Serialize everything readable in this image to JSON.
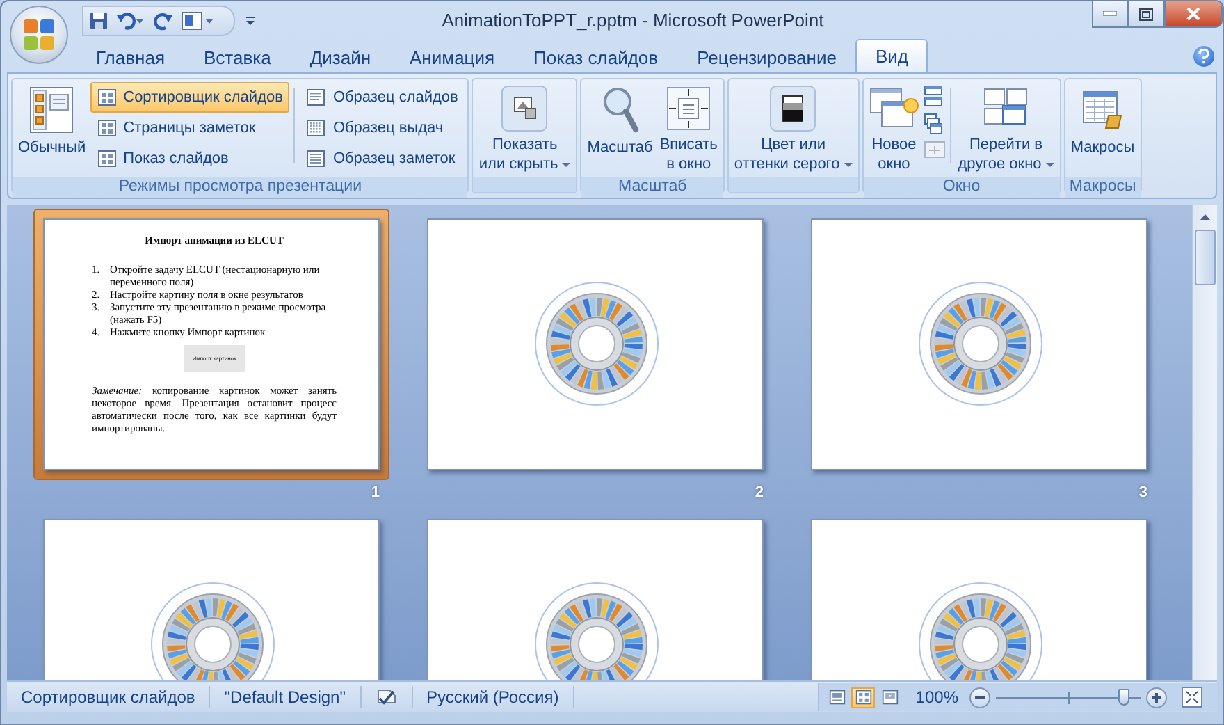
{
  "window": {
    "title": "AnimationToPPT_r.pptm - Microsoft PowerPoint"
  },
  "tabs": [
    {
      "label": "Главная",
      "selected": false
    },
    {
      "label": "Вставка",
      "selected": false
    },
    {
      "label": "Дизайн",
      "selected": false
    },
    {
      "label": "Анимация",
      "selected": false
    },
    {
      "label": "Показ слайдов",
      "selected": false
    },
    {
      "label": "Рецензирование",
      "selected": false
    },
    {
      "label": "Вид",
      "selected": true
    }
  ],
  "ribbon_groups": [
    {
      "label": "Режимы просмотра презентации",
      "items": [
        {
          "kind": "large",
          "lines": [
            "Обычный"
          ],
          "dropdown": false
        },
        {
          "kind": "stack",
          "items": [
            {
              "label": "Сортировщик слайдов",
              "selected": true
            },
            {
              "label": "Страницы заметок",
              "selected": false
            },
            {
              "label": "Показ слайдов",
              "selected": false
            }
          ]
        },
        {
          "kind": "separator"
        },
        {
          "kind": "stack",
          "items": [
            {
              "label": "Образец слайдов",
              "selected": false
            },
            {
              "label": "Образец выдач",
              "selected": false
            },
            {
              "label": "Образец заметок",
              "selected": false
            }
          ]
        }
      ]
    },
    {
      "items": [
        {
          "kind": "large",
          "lines": [
            "Показать",
            "или скрыть"
          ],
          "dropdown": true
        }
      ]
    },
    {
      "label": "Масштаб",
      "items": [
        {
          "kind": "large",
          "lines": [
            "Масштаб"
          ],
          "dropdown": false
        },
        {
          "kind": "large",
          "lines": [
            "Вписать",
            "в окно"
          ],
          "dropdown": false
        }
      ]
    },
    {
      "items": [
        {
          "kind": "large",
          "lines": [
            "Цвет или",
            "оттенки серого"
          ],
          "dropdown": true
        }
      ]
    },
    {
      "label": "Окно",
      "items": [
        {
          "kind": "large",
          "lines": [
            "Новое",
            "окно"
          ],
          "dropdown": false
        },
        {
          "kind": "icons"
        },
        {
          "kind": "separator"
        },
        {
          "kind": "large",
          "lines": [
            "Перейти в",
            "другое окно"
          ],
          "dropdown": true
        }
      ]
    },
    {
      "label": "Макросы",
      "items": [
        {
          "kind": "large",
          "lines": [
            "Макросы"
          ],
          "dropdown": false
        }
      ]
    }
  ],
  "slides": [
    {
      "kind": "text",
      "number": "1",
      "selected": true,
      "title": "Импорт анимации из ELCUT",
      "steps": [
        {
          "number": "1.",
          "text": "Откройте задачу ELCUT (нестационарную или переменного поля)"
        },
        {
          "number": "2.",
          "text": "Настройте картину поля в окне результатов"
        },
        {
          "number": "3.",
          "text": "Запустите эту презентацию в режиме просмотра (нажать F5)"
        },
        {
          "number": "4.",
          "text": "Нажмите кнопку Импорт картинок"
        }
      ],
      "button": "Импорт картинок",
      "note": "*Замечание:* копирование картинок может занять некоторое время. Презентация остановит процесс автоматически после того, как все картинки будут импортированы."
    },
    {
      "kind": "stator",
      "number": "2",
      "selected": false
    },
    {
      "kind": "stator",
      "number": "3",
      "selected": false
    },
    {
      "kind": "stator",
      "selected": false
    },
    {
      "kind": "stator",
      "selected": false
    },
    {
      "kind": "stator",
      "selected": false
    }
  ],
  "status_bar": {
    "items": [
      {
        "kind": "text",
        "text": "Сортировщик слайдов"
      },
      {
        "kind": "text",
        "text": "\"Default Design\""
      },
      {
        "kind": "icon"
      },
      {
        "kind": "text",
        "text": "Русский (Россия)"
      }
    ],
    "views": [
      {
        "selected": false
      },
      {
        "selected": true
      },
      {
        "selected": false
      }
    ],
    "zoom": "100%",
    "zoom_slider": {
      "level": 0.88
    }
  }
}
